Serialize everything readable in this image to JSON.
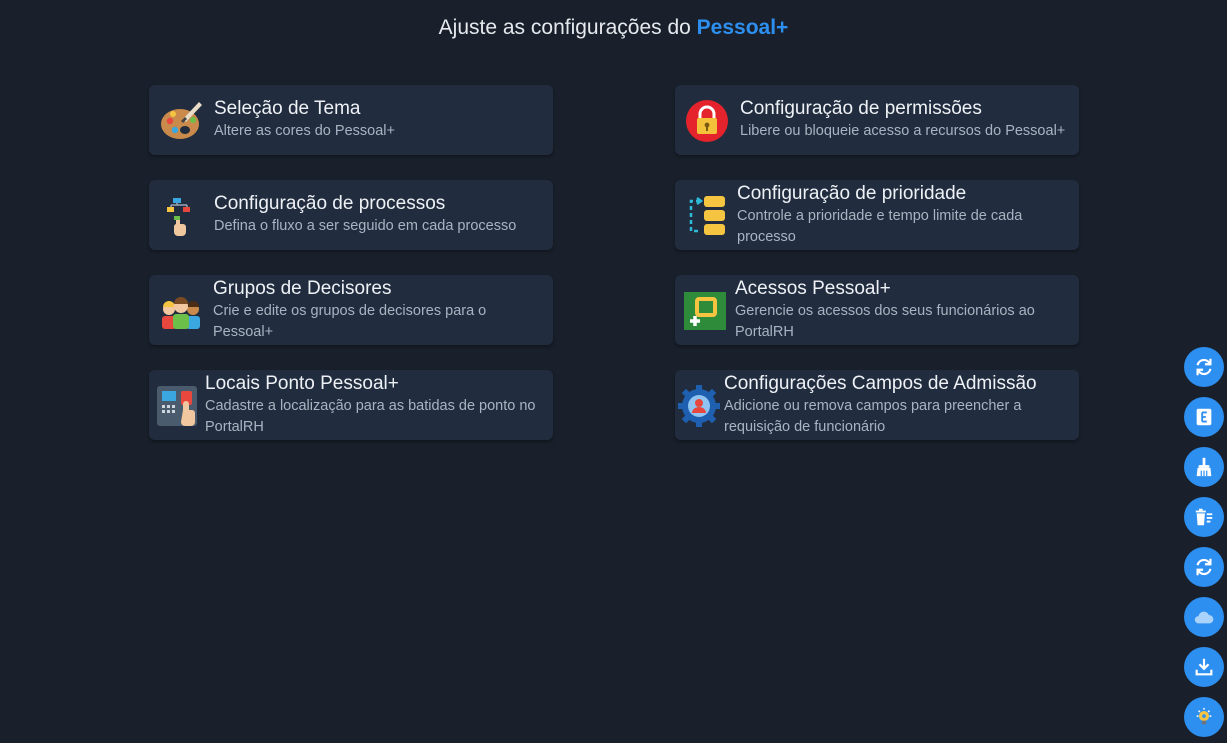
{
  "header": {
    "title_prefix": "Ajuste as configurações do",
    "title_brand": "Pessoal+"
  },
  "cards": [
    {
      "icon": "palette-icon",
      "title": "Seleção de Tema",
      "desc": "Altere as cores do Pessoal+"
    },
    {
      "icon": "padlock-icon",
      "title": "Configuração de permissões",
      "desc": "Libere ou bloqueie acesso a recursos do Pessoal+"
    },
    {
      "icon": "flowchart-hand-icon",
      "title": "Configuração de processos",
      "desc": "Defina o fluxo a ser seguido em cada processo"
    },
    {
      "icon": "priority-stack-icon",
      "title": "Configuração de prioridade",
      "desc": "Controle a prioridade e tempo limite de cada processo"
    },
    {
      "icon": "people-group-icon",
      "title": "Grupos de Decisores",
      "desc": "Crie e edite os grupos de decisores para o Pessoal+"
    },
    {
      "icon": "access-key-icon",
      "title": "Acessos Pessoal+",
      "desc": "Gerencie os acessos dos seus funcionários ao PortalRH"
    },
    {
      "icon": "time-clock-icon",
      "title": "Locais Ponto Pessoal+",
      "desc": "Cadastre a localização para as batidas de ponto no PortalRH"
    },
    {
      "icon": "user-gear-icon",
      "title": "Configurações Campos de Admissão",
      "desc": "Adicione ou remova campos para preencher a requisição de funcionário"
    }
  ],
  "side_buttons": [
    {
      "icon": "refresh-icon"
    },
    {
      "icon": "letter-e-icon"
    },
    {
      "icon": "broom-icon"
    },
    {
      "icon": "delete-list-icon"
    },
    {
      "icon": "sync-icon"
    },
    {
      "icon": "cloud-icon"
    },
    {
      "icon": "download-icon"
    },
    {
      "icon": "lightbulb-icon"
    }
  ],
  "colors": {
    "background": "#19202b",
    "card": "#212d3e",
    "accent": "#2d8ff0"
  }
}
